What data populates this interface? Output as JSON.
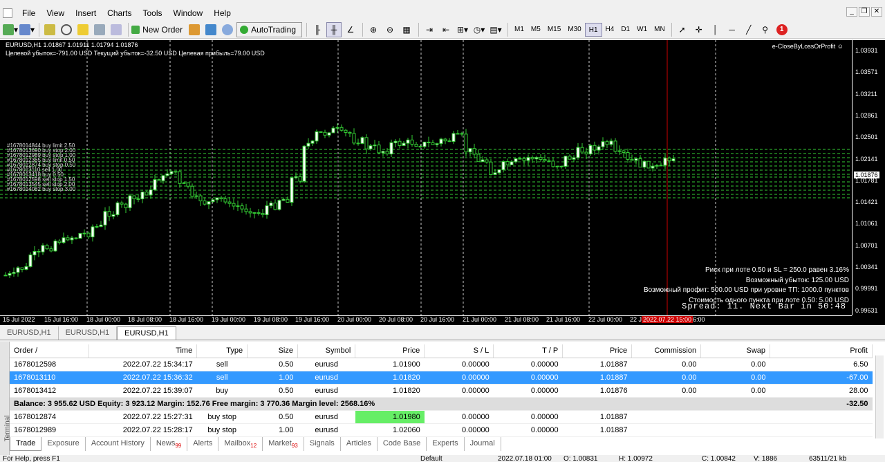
{
  "menu": [
    "File",
    "View",
    "Insert",
    "Charts",
    "Tools",
    "Window",
    "Help"
  ],
  "toolbar": {
    "new_order": "New Order",
    "autotrading": "AutoTrading",
    "timeframes": [
      "M1",
      "M5",
      "M15",
      "M30",
      "H1",
      "H4",
      "D1",
      "W1",
      "MN"
    ],
    "active_tf": "H1",
    "alert_count": "1"
  },
  "chart": {
    "symbol_line": "EURUSD,H1  1.01867 1.01911 1.01794 1.01876",
    "targets_line": "Целевой убыток=-791.00 USD  Текущий убыток=-32.50 USD  Целевая прибыль=79.00 USD",
    "ea_name": "e-CloseByLossOrProfit ☺",
    "prices": [
      "1.03931",
      "1.03571",
      "1.03211",
      "1.02861",
      "1.02501",
      "1.02141",
      "1.01781",
      "1.01421",
      "1.01061",
      "1.00701",
      "1.00341",
      "0.99991",
      "0.99631"
    ],
    "current_price": "1.01876",
    "times": [
      "15 Jul 2022",
      "15 Jul 16:00",
      "18 Jul 00:00",
      "18 Jul 08:00",
      "18 Jul 16:00",
      "19 Jul 00:00",
      "19 Jul 08:00",
      "19 Jul 16:00",
      "20 Jul 00:00",
      "20 Jul 08:00",
      "20 Jul 16:00",
      "21 Jul 00:00",
      "21 Jul 08:00",
      "21 Jul 16:00",
      "22 Jul 00:00",
      "22 Ju",
      "6:00"
    ],
    "time_highlight": "2022.07.22 15:00",
    "info": [
      "Риск при лоте 0.50 и SL = 250.0 равен 3.16%",
      "Возможный убыток: 125.00 USD",
      "Возможный профит: 500.00 USD при уровне ТП: 1000.0 пунктов",
      "Стоимость одного пункта при лоте 0.50: 5.00 USD"
    ],
    "spread": "Spread: 11. Next Bar in 50:48",
    "order_labels": [
      "#1678014844 buy limit 2.50",
      "#1678013690 buy stop 2.00",
      "#1678012989 buy stop 1.00",
      "#1678012365 buy limit 0.50",
      "#1678012874 buy stop 0.50",
      "#1678013110 sell 1.00",
      "#1678013418 buy 0.50",
      "#1678012598 sell stop 1.50",
      "#1678013545 sell stop 2.00",
      "#1678014082 buy stop 3.00"
    ]
  },
  "chart_tabs": [
    "EURUSD,H1",
    "EURUSD,H1",
    "EURUSD,H1"
  ],
  "columns": [
    "Order",
    "Time",
    "Type",
    "Size",
    "Symbol",
    "Price",
    "S / L",
    "T / P",
    "Price",
    "Commission",
    "Swap",
    "Profit"
  ],
  "rows": [
    [
      "1678012598",
      "2022.07.22 15:34:17",
      "sell",
      "0.50",
      "eurusd",
      "1.01900",
      "0.00000",
      "0.00000",
      "1.01887",
      "0.00",
      "0.00",
      "6.50"
    ],
    [
      "1678013110",
      "2022.07.22 15:36:32",
      "sell",
      "1.00",
      "eurusd",
      "1.01820",
      "0.00000",
      "0.00000",
      "1.01887",
      "0.00",
      "0.00",
      "-67.00"
    ],
    [
      "1678013412",
      "2022.07.22 15:39:07",
      "buy",
      "0.50",
      "eurusd",
      "1.01820",
      "0.00000",
      "0.00000",
      "1.01876",
      "0.00",
      "0.00",
      "28.00"
    ]
  ],
  "balance": {
    "text": "Balance: 3 955.62 USD  Equity: 3 923.12  Margin: 152.76  Free margin: 3 770.36  Margin level: 2568.16%",
    "profit": "-32.50"
  },
  "pending": [
    [
      "1678012874",
      "2022.07.22 15:27:31",
      "buy stop",
      "0.50",
      "eurusd",
      "1.01980",
      "0.00000",
      "0.00000",
      "1.01887"
    ],
    [
      "1678012989",
      "2022.07.22 15:28:17",
      "buy stop",
      "1.00",
      "eurusd",
      "1.02060",
      "0.00000",
      "0.00000",
      "1.01887"
    ]
  ],
  "terminal_tabs": [
    {
      "label": "Trade"
    },
    {
      "label": "Exposure"
    },
    {
      "label": "Account History"
    },
    {
      "label": "News",
      "badge": "99"
    },
    {
      "label": "Alerts"
    },
    {
      "label": "Mailbox",
      "badge": "12"
    },
    {
      "label": "Market",
      "badge": "93"
    },
    {
      "label": "Signals"
    },
    {
      "label": "Articles"
    },
    {
      "label": "Code Base"
    },
    {
      "label": "Experts"
    },
    {
      "label": "Journal"
    }
  ],
  "terminal_side": "Terminal",
  "status": {
    "help": "For Help, press F1",
    "profile": "Default",
    "time": "2022.07.18 01:00",
    "open": "O: 1.00831",
    "high": "H: 1.00972",
    "close": "C: 1.00842",
    "volume": "V: 1886",
    "traffic": "63511/21 kb"
  }
}
